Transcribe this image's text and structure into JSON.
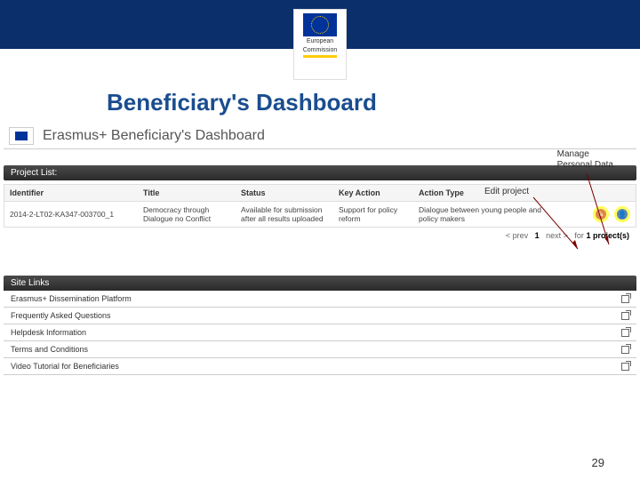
{
  "header": {
    "ec_label_1": "European",
    "ec_label_2": "Commission"
  },
  "slide": {
    "title": "Beneficiary's Dashboard",
    "page_number": "29"
  },
  "app": {
    "title": "Erasmus+ Beneficiary's Dashboard"
  },
  "callouts": {
    "manage_l1": "Manage",
    "manage_l2": "Personal Data",
    "edit": "Edit project"
  },
  "project_list": {
    "section": "Project List:",
    "headers": {
      "identifier": "Identifier",
      "title": "Title",
      "status": "Status",
      "key_action": "Key Action",
      "action_type": "Action Type"
    },
    "row": {
      "identifier": "2014-2-LT02-KA347-003700_1",
      "title": "Democracy through Dialogue no Conflict",
      "status": "Available for submission after all results uploaded",
      "key_action": "Support for policy reform",
      "action_type": "Dialogue between young people and policy makers"
    },
    "pager": {
      "prev": "< prev",
      "page": "1",
      "next": "next >",
      "for": "for",
      "count": "1",
      "label": "project(s)"
    }
  },
  "site_links": {
    "header": "Site Links",
    "items": [
      "Erasmus+ Dissemination Platform",
      "Frequently Asked Questions",
      "Helpdesk Information",
      "Terms and Conditions",
      "Video Tutorial for Beneficiaries"
    ]
  }
}
